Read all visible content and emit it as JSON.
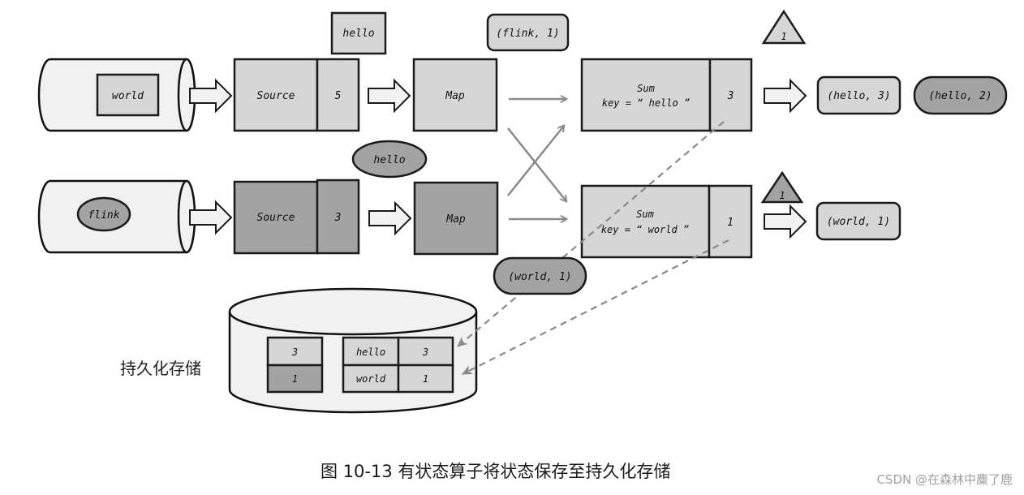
{
  "colors": {
    "light_fill": "#d6d6d6",
    "dark_fill": "#a3a3a3",
    "cylinder_fill": "#f1f1f1",
    "stroke": "#1a1a1a",
    "flow_arrow": "#8a8a8a"
  },
  "input_streams": [
    {
      "record": "world",
      "record_shape": "rectangle"
    },
    {
      "record": "flink",
      "record_shape": "ellipse"
    }
  ],
  "sources": [
    {
      "label": "Source",
      "offset": "5"
    },
    {
      "label": "Source",
      "offset": "3"
    }
  ],
  "in_flight": {
    "between_source1_map1": "hello",
    "between_source2_map2": "hello",
    "above_map1_output": "(flink, 1)",
    "below_sum2_input": "(world, 1)"
  },
  "maps": [
    {
      "label": "Map"
    },
    {
      "label": "Map"
    }
  ],
  "sums": [
    {
      "title": "Sum",
      "key_line": "key = “ hello ”",
      "state": "3",
      "barrier": "1",
      "outputs": [
        "(hello, 3)",
        "(hello, 2)"
      ]
    },
    {
      "title": "Sum",
      "key_line": "key = “ world ”",
      "state": "1",
      "barrier": "1",
      "outputs": [
        "(world, 1)"
      ]
    }
  ],
  "storage": {
    "label": "持久化存储",
    "source_offsets": [
      "3",
      "1"
    ],
    "keyed_state": [
      {
        "key": "hello",
        "value": "3"
      },
      {
        "key": "world",
        "value": "1"
      }
    ]
  },
  "caption": "图 10-13  有状态算子将状态保存至持久化存储",
  "watermark": "CSDN @在森林中麋了鹿"
}
